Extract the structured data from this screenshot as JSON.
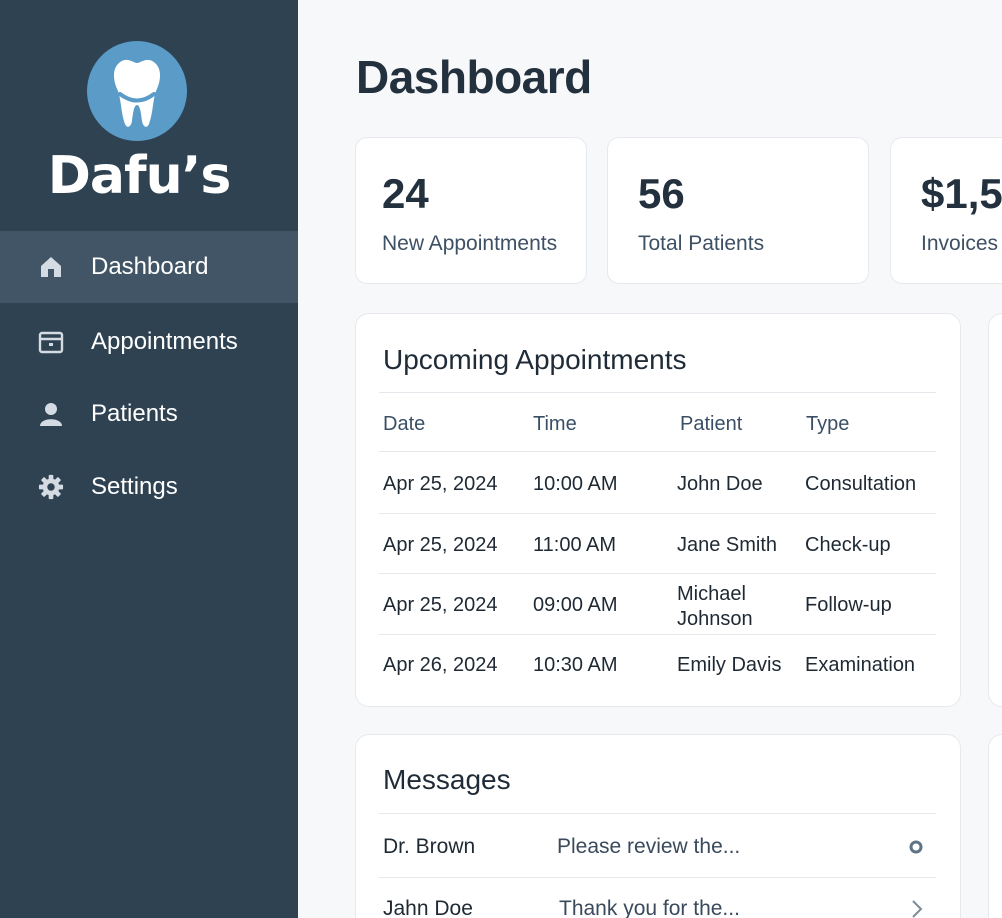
{
  "brand": {
    "name": "Dafu’s",
    "logo_icon": "tooth-icon",
    "logo_color": "#5a9bc8"
  },
  "sidebar": {
    "items": [
      {
        "label": "Dashboard",
        "icon": "home-icon",
        "active": true
      },
      {
        "label": "Appointments",
        "icon": "calendar-icon",
        "active": false
      },
      {
        "label": "Patients",
        "icon": "user-icon",
        "active": false
      },
      {
        "label": "Settings",
        "icon": "gear-icon",
        "active": false
      }
    ]
  },
  "page": {
    "title": "Dashboard"
  },
  "stats": [
    {
      "value": "24",
      "label": "New Appointments"
    },
    {
      "value": "56",
      "label": "Total Patients"
    },
    {
      "value": "$1,5",
      "label": "Invoices"
    }
  ],
  "appointments": {
    "title": "Upcoming Appointments",
    "columns": [
      "Date",
      "Time",
      "Patient",
      "Type"
    ],
    "rows": [
      {
        "date": "Apr 25, 2024",
        "time": "10:00 AM",
        "patient": "John Doe",
        "type": "Consultation"
      },
      {
        "date": "Apr 25, 2024",
        "time": "11:00 AM",
        "patient": "Jane Smith",
        "type": "Check-up"
      },
      {
        "date": "Apr 25, 2024",
        "time": "09:00 AM",
        "patient": "Michael Johnson",
        "type": "Follow-up"
      },
      {
        "date": "Apr 26, 2024",
        "time": "10:30 AM",
        "patient": "Emily Davis",
        "type": "Examination"
      }
    ]
  },
  "messages": {
    "title": "Messages",
    "items": [
      {
        "sender": "Dr. Brown",
        "preview": "Please review the...",
        "icon": "unread-dot-icon"
      },
      {
        "sender": "Jahn Doe",
        "preview": "Thank you for the...",
        "icon": "chevron-right-icon"
      }
    ]
  },
  "colors": {
    "sidebar": "#2f4252",
    "sidebar_active": "#415566",
    "text_dark": "#23303d"
  }
}
